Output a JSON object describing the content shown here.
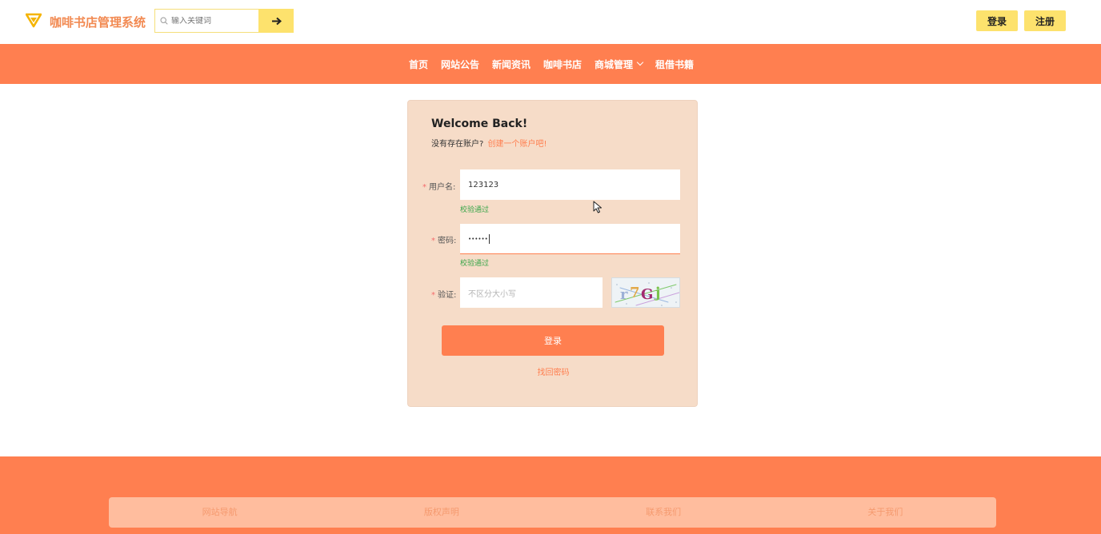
{
  "header": {
    "brand": "咖啡书店管理系统",
    "search_placeholder": "输入关键词",
    "search_button_icon": "arrow-right-icon",
    "login_label": "登录",
    "register_label": "注册"
  },
  "nav": {
    "items": [
      {
        "label": "首页"
      },
      {
        "label": "网站公告"
      },
      {
        "label": "新闻资讯"
      },
      {
        "label": "咖啡书店"
      },
      {
        "label": "商城管理"
      },
      {
        "label": "租借书籍"
      }
    ]
  },
  "login_card": {
    "title": "Welcome Back!",
    "subtitle_prefix": "没有存在账户?",
    "create_account_link": "创建一个账户吧!",
    "username_label": "用户名:",
    "username_value": "123123",
    "username_status": "校验通过",
    "password_label": "密码:",
    "password_value": "••••••",
    "password_status": "校验通过",
    "captcha_label": "验证:",
    "captcha_placeholder": "不区分大小写",
    "captcha_text": "r7Gj",
    "submit_label": "登录",
    "forgot_label": "找回密码"
  },
  "footer": {
    "links": [
      {
        "label": "网站导航"
      },
      {
        "label": "版权声明"
      },
      {
        "label": "联系我们"
      },
      {
        "label": "关于我们"
      }
    ]
  },
  "colors": {
    "accent": "#ff7f50",
    "yellow": "#fde26d",
    "card_bg": "#f6dcc8",
    "success": "#3aa64a"
  }
}
